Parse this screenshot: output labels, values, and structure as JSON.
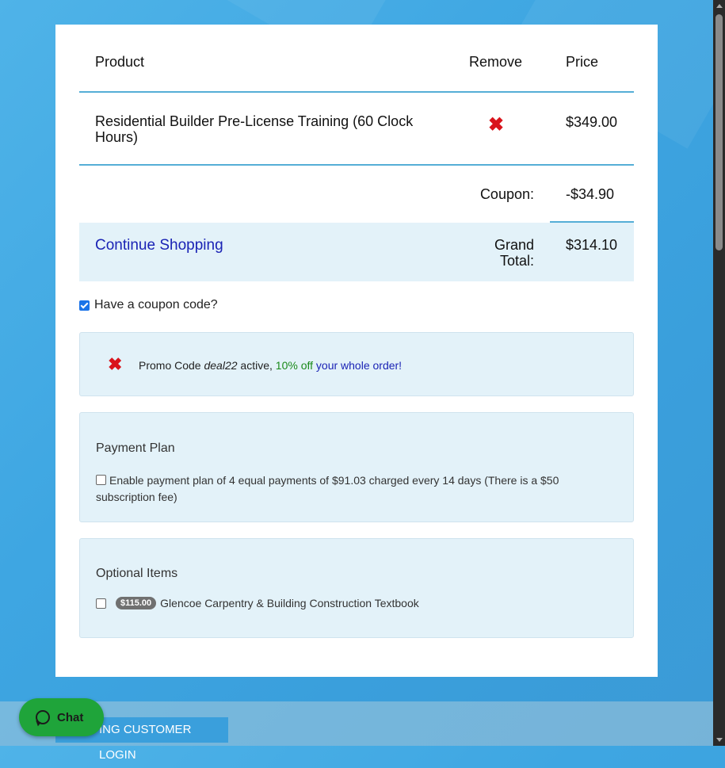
{
  "cart": {
    "headers": {
      "product": "Product",
      "remove": "Remove",
      "price": "Price"
    },
    "items": [
      {
        "name": "Residential Builder Pre-License Training (60 Clock Hours)",
        "remove_icon": "✖",
        "price": "$349.00"
      }
    ],
    "coupon_label": "Coupon:",
    "coupon_value": "-$34.90",
    "continue_link": "Continue Shopping",
    "grand_total_label": "Grand Total:",
    "grand_total_value": "$314.10"
  },
  "coupon_toggle": {
    "label": "Have a coupon code?",
    "checked": true
  },
  "promo": {
    "remove_icon": "✖",
    "prefix": "Promo Code ",
    "code": "deal22",
    "middle": " active, ",
    "discount": "10% off",
    "suffix": " your whole order!"
  },
  "payment_plan": {
    "title": "Payment Plan",
    "text": "Enable payment plan of 4 equal payments of $91.03 charged every 14 days (There is a $50 subscription fee)"
  },
  "optional_items": {
    "title": "Optional Items",
    "items": [
      {
        "price_badge": "$115.00",
        "name": "Glencoe Carpentry & Building Construction Textbook"
      }
    ]
  },
  "footer": {
    "login_label": "ING CUSTOMER LOGIN",
    "chat_label": "Chat"
  },
  "colors": {
    "accent_blue": "#55aed6",
    "link_blue": "#1a23b5",
    "remove_red": "#d9141c",
    "panel_bg": "#e3f2f9",
    "chat_green": "#1fa43a"
  }
}
